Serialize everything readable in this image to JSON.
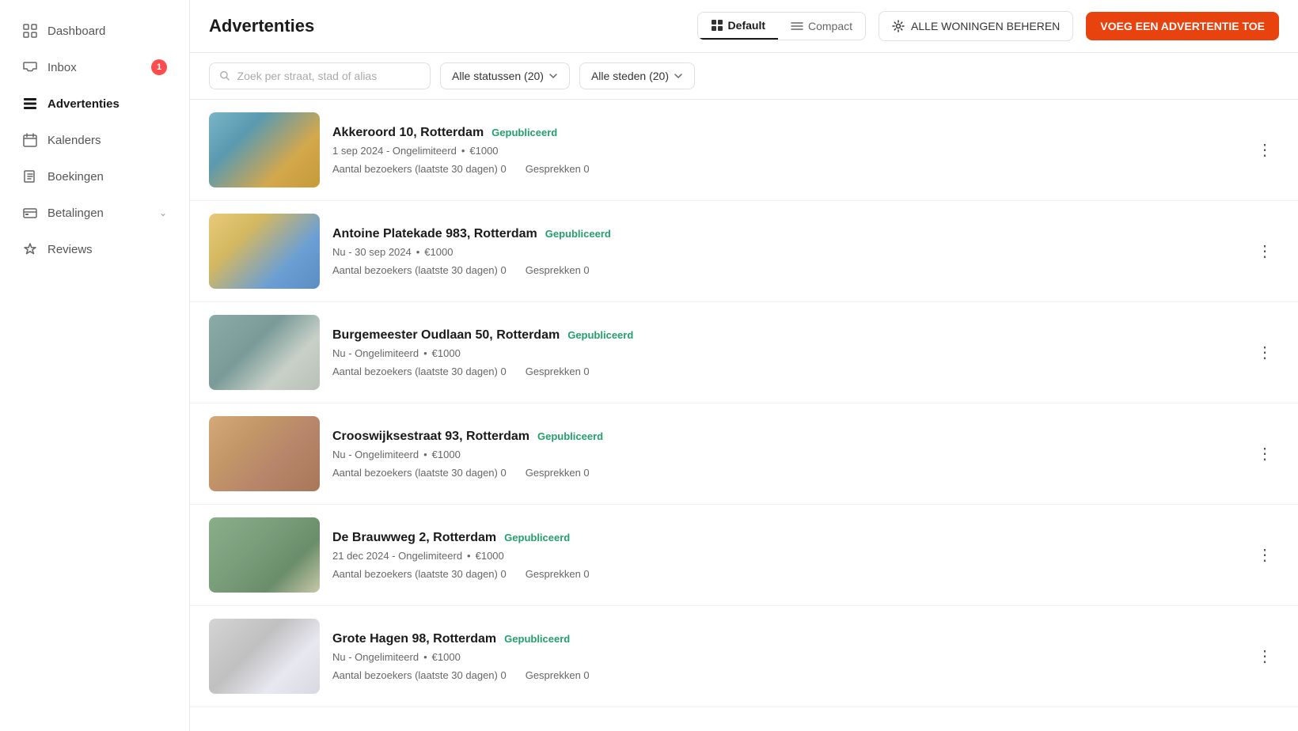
{
  "sidebar": {
    "items": [
      {
        "id": "dashboard",
        "label": "Dashboard",
        "icon": "grid-icon",
        "active": false,
        "badge": null
      },
      {
        "id": "inbox",
        "label": "Inbox",
        "icon": "inbox-icon",
        "active": false,
        "badge": "1"
      },
      {
        "id": "advertenties",
        "label": "Advertenties",
        "icon": "list-icon",
        "active": true,
        "badge": null
      },
      {
        "id": "kalenders",
        "label": "Kalenders",
        "icon": "calendar-icon",
        "active": false,
        "badge": null
      },
      {
        "id": "boekingen",
        "label": "Boekingen",
        "icon": "book-icon",
        "active": false,
        "badge": null
      },
      {
        "id": "betalingen",
        "label": "Betalingen",
        "icon": "credit-icon",
        "active": false,
        "badge": null,
        "hasChevron": true
      },
      {
        "id": "reviews",
        "label": "Reviews",
        "icon": "star-icon",
        "active": false,
        "badge": null
      }
    ]
  },
  "header": {
    "title": "Advertenties",
    "view_default_label": "Default",
    "view_compact_label": "Compact",
    "manage_btn_label": "ALLE WONINGEN BEHEREN",
    "add_btn_label": "VOEG EEN ADVERTENTIE TOE"
  },
  "filters": {
    "search_placeholder": "Zoek per straat, stad of alias",
    "status_filter_label": "Alle statussen (20)",
    "city_filter_label": "Alle steden (20)"
  },
  "listings": [
    {
      "id": 1,
      "title": "Akkeroord 10, Rotterdam",
      "status": "Gepubliceerd",
      "meta": "1 sep 2024 - Ongelimiteerd",
      "price": "€1000",
      "visitors": "0",
      "conversations": "0",
      "img_class": "img-akkeroord"
    },
    {
      "id": 2,
      "title": "Antoine Platekade 983, Rotterdam",
      "status": "Gepubliceerd",
      "meta": "Nu - 30 sep 2024",
      "price": "€1000",
      "visitors": "0",
      "conversations": "0",
      "img_class": "img-antoine"
    },
    {
      "id": 3,
      "title": "Burgemeester Oudlaan 50, Rotterdam",
      "status": "Gepubliceerd",
      "meta": "Nu - Ongelimiteerd",
      "price": "€1000",
      "visitors": "0",
      "conversations": "0",
      "img_class": "img-burgemeester"
    },
    {
      "id": 4,
      "title": "Crooswijksestraat 93, Rotterdam",
      "status": "Gepubliceerd",
      "meta": "Nu - Ongelimiteerd",
      "price": "€1000",
      "visitors": "0",
      "conversations": "0",
      "img_class": "img-crooswijkse"
    },
    {
      "id": 5,
      "title": "De Brauwweg 2, Rotterdam",
      "status": "Gepubliceerd",
      "meta": "21 dec 2024 - Ongelimiteerd",
      "price": "€1000",
      "visitors": "0",
      "conversations": "0",
      "img_class": "img-brauwweg"
    },
    {
      "id": 6,
      "title": "Grote Hagen 98, Rotterdam",
      "status": "Gepubliceerd",
      "meta": "Nu - Ongelimiteerd",
      "price": "€1000",
      "visitors": "0",
      "conversations": "0",
      "img_class": "img-grotehagen"
    }
  ],
  "labels": {
    "visitors_label": "Aantal bezoekers (laatste 30 dagen)",
    "conversations_label": "Gesprekken",
    "dot_separator": "•"
  }
}
